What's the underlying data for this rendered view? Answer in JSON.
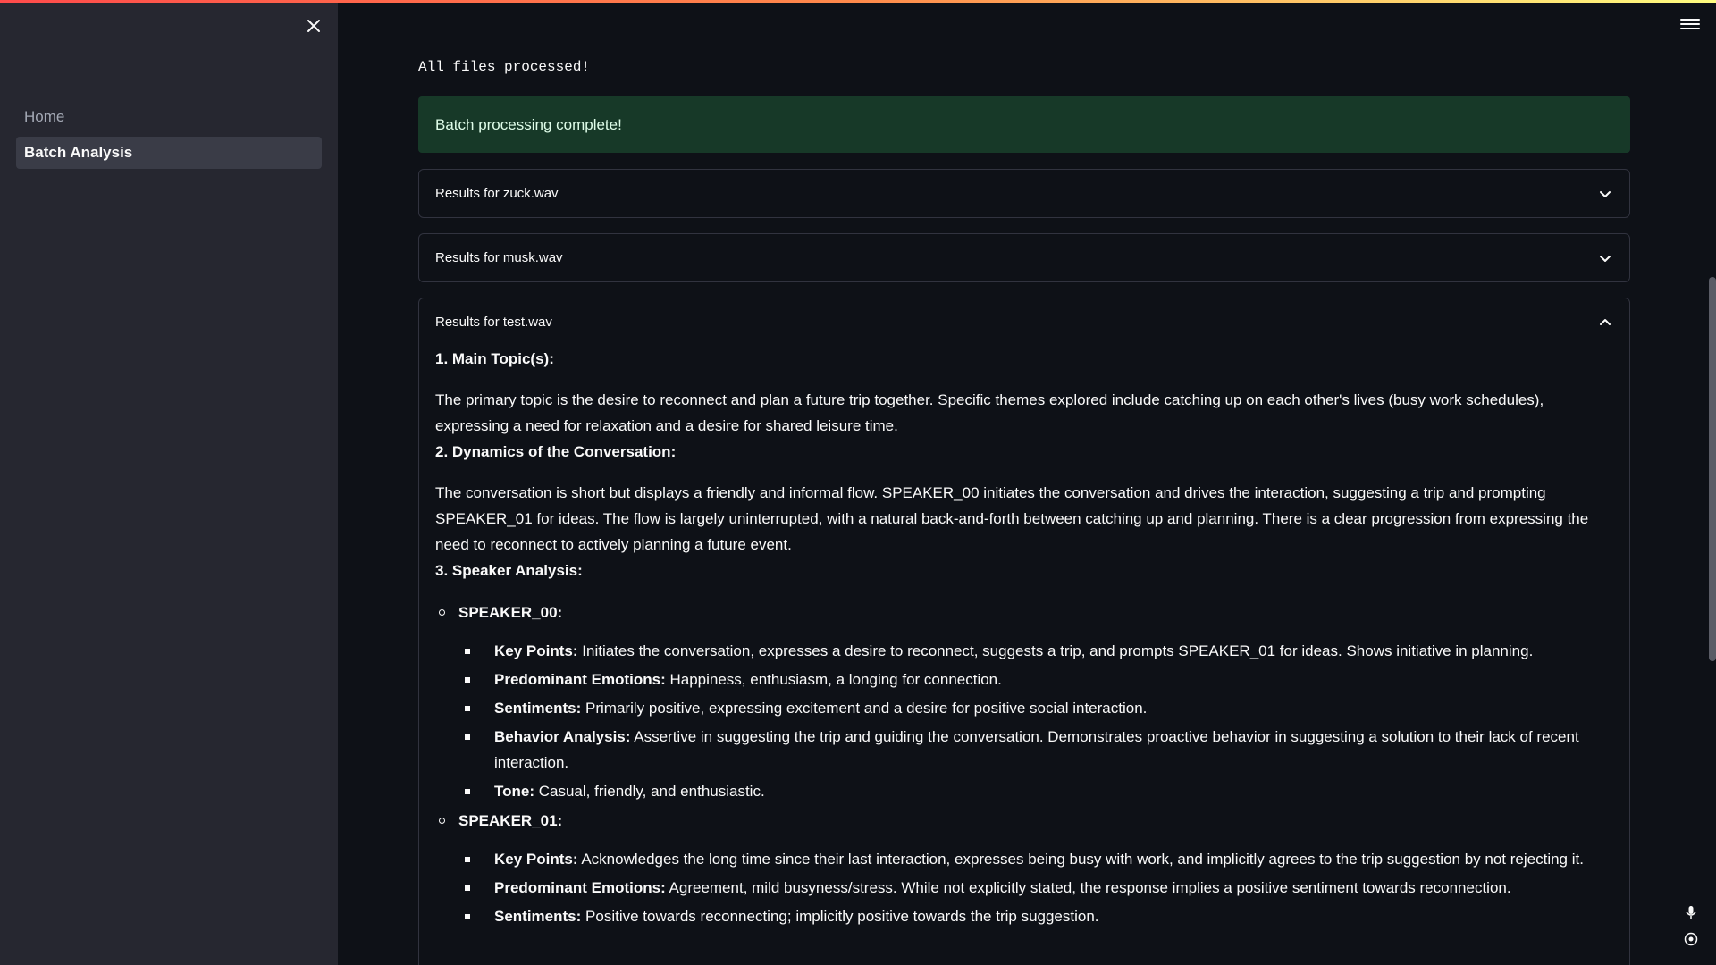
{
  "sidebar": {
    "items": [
      {
        "label": "Home"
      },
      {
        "label": "Batch Analysis"
      }
    ]
  },
  "main": {
    "status_line": "All files processed!",
    "success_message": "Batch processing complete!",
    "expanders": [
      {
        "title": "Results for zuck.wav"
      },
      {
        "title": "Results for musk.wav"
      },
      {
        "title": "Results for test.wav"
      }
    ],
    "analysis": {
      "h1": "1. Main Topic(s):",
      "p1": "The primary topic is the desire to reconnect and plan a future trip together. Specific themes explored include catching up on each other's lives (busy work schedules), expressing a need for relaxation and a desire for shared leisure time.",
      "h2": "2. Dynamics of the Conversation:",
      "p2": "The conversation is short but displays a friendly and informal flow. SPEAKER_00 initiates the conversation and drives the interaction, suggesting a trip and prompting SPEAKER_01 for ideas. The flow is largely uninterrupted, with a natural back-and-forth between catching up and planning. There is a clear progression from expressing the need to reconnect to actively planning a future event.",
      "h3": "3. Speaker Analysis:",
      "speakers": [
        {
          "name": "SPEAKER_00:",
          "points": [
            {
              "label": "Key Points:",
              "text": "Initiates the conversation, expresses a desire to reconnect, suggests a trip, and prompts SPEAKER_01 for ideas. Shows initiative in planning."
            },
            {
              "label": "Predominant Emotions:",
              "text": "Happiness, enthusiasm, a longing for connection."
            },
            {
              "label": "Sentiments:",
              "text": "Primarily positive, expressing excitement and a desire for positive social interaction."
            },
            {
              "label": "Behavior Analysis:",
              "text": "Assertive in suggesting the trip and guiding the conversation. Demonstrates proactive behavior in suggesting a solution to their lack of recent interaction."
            },
            {
              "label": "Tone:",
              "text": "Casual, friendly, and enthusiastic."
            }
          ]
        },
        {
          "name": "SPEAKER_01:",
          "points": [
            {
              "label": "Key Points:",
              "text": "Acknowledges the long time since their last interaction, expresses being busy with work, and implicitly agrees to the trip suggestion by not rejecting it."
            },
            {
              "label": "Predominant Emotions:",
              "text": "Agreement, mild busyness/stress. While not explicitly stated, the response implies a positive sentiment towards reconnection."
            },
            {
              "label": "Sentiments:",
              "text": "Positive towards reconnecting; implicitly positive towards the trip suggestion."
            }
          ]
        }
      ]
    }
  },
  "icons": {
    "close": "close-icon",
    "menu": "hamburger-menu-icon",
    "expand": "chevron-down-icon",
    "collapse": "chevron-up-icon",
    "mic": "microphone-icon",
    "target": "target-icon"
  },
  "colors": {
    "accent_gradient_start": "#ff4b4b",
    "accent_gradient_end": "#fffd80",
    "success_bg": "#173928",
    "background": "#0e1117",
    "sidebar_bg": "#262730"
  }
}
